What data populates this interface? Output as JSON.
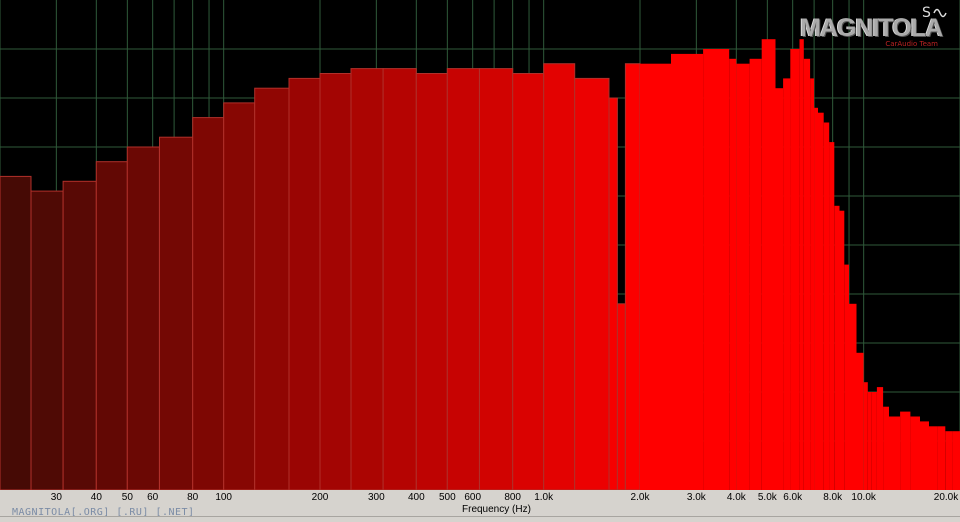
{
  "chart_data": {
    "type": "bar",
    "xlabel": "Frequency (Hz)",
    "x_scale": "log",
    "xlim": [
      20,
      20000
    ],
    "ylim": [
      0,
      100
    ],
    "grid": true,
    "tick_labels": [
      "30",
      "40",
      "50",
      "60",
      "80",
      "100",
      "200",
      "300",
      "400",
      "500",
      "600",
      "800",
      "1.0k",
      "2.0k",
      "3.0k",
      "4.0k",
      "5.0k",
      "6.0k",
      "8.0k",
      "10.0k",
      "20.0k"
    ],
    "tick_values": [
      30,
      40,
      50,
      60,
      80,
      100,
      200,
      300,
      400,
      500,
      600,
      800,
      1000,
      2000,
      3000,
      4000,
      5000,
      6000,
      8000,
      10000,
      20000
    ],
    "series": [
      {
        "color": "#ff0000",
        "frequencies": [
          20,
          25,
          31.5,
          40,
          50,
          63,
          80,
          100,
          125,
          160,
          200,
          250,
          315,
          400,
          500,
          630,
          800,
          1000,
          1250,
          1600,
          1700,
          1800,
          2000,
          2500,
          3150,
          3800,
          4000,
          4400,
          4800,
          5300,
          5600,
          5900,
          6300,
          6500,
          6800,
          7000,
          7200,
          7500,
          7800,
          8100,
          8400,
          8700,
          9000,
          9500,
          10000,
          10300,
          10600,
          11000,
          11500,
          12000,
          13000,
          14000,
          15000,
          16000,
          17000,
          18000,
          19000,
          20000
        ],
        "values": [
          64,
          61,
          63,
          67,
          70,
          72,
          76,
          79,
          82,
          84,
          85,
          86,
          86,
          85,
          86,
          86,
          85,
          87,
          84,
          80,
          38,
          87,
          87,
          89,
          90,
          88,
          87,
          88,
          92,
          82,
          84,
          90,
          92,
          88,
          84,
          78,
          77,
          75,
          71,
          58,
          57,
          46,
          38,
          28,
          22,
          20,
          20,
          21,
          17,
          15,
          16,
          15,
          14,
          13,
          13,
          12,
          12,
          12
        ]
      }
    ]
  },
  "logo": {
    "text": "MAGNITOLA",
    "sub": "CarAudio Team"
  },
  "watermark": "MAGNITOLA[.ORG] [.RU] [.NET]",
  "colors": {
    "background": "#000000",
    "grid": "#2f5a3a",
    "fill": "#ff0000",
    "axis_band": "#d6d3ce"
  }
}
